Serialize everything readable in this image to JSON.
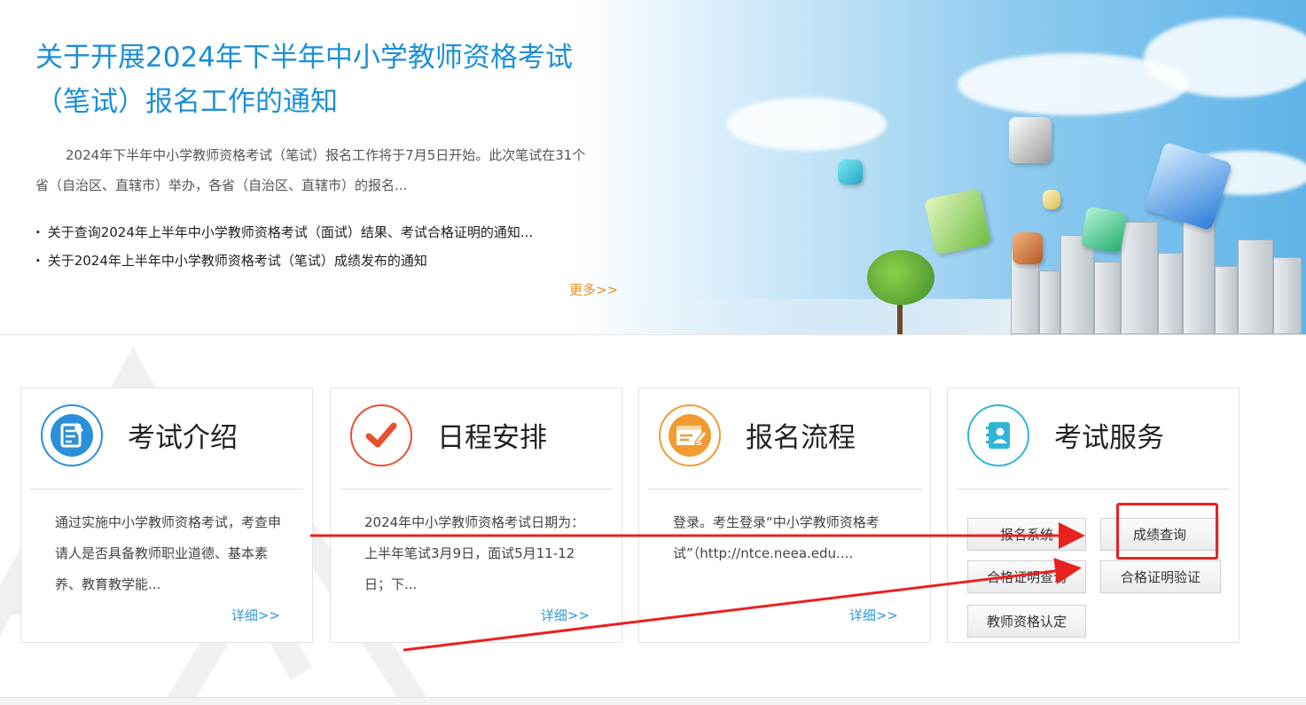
{
  "news": {
    "title": "关于开展2024年下半年中小学教师资格考试（笔试）报名工作的通知",
    "summary": "2024年下半年中小学教师资格考试（笔试）报名工作将于7月5日开始。此次笔试在31个省（自治区、直辖市）举办，各省（自治区、直辖市）的报名...",
    "items": [
      "关于查询2024年上半年中小学教师资格考试（面试）结果、考试合格证明的通知...",
      "关于2024年上半年中小学教师资格考试（笔试）成绩发布的通知"
    ],
    "more": "更多>>"
  },
  "cards": {
    "intro": {
      "title": "考试介绍",
      "icon": "document-edit-icon",
      "text": "通过实施中小学教师资格考试，考查申请人是否具备教师职业道德、基本素养、教育教学能...",
      "detail": "详细>>"
    },
    "schedule": {
      "title": "日程安排",
      "icon": "checkmark-icon",
      "text": "2024年中小学教师资格考试日期为：上半年笔试3月9日，面试5月11-12日；下...",
      "detail": "详细>>"
    },
    "registration": {
      "title": "报名流程",
      "icon": "browser-edit-icon",
      "text": "登录。考生登录“中小学教师资格考试”（http://ntce.neea.edu....",
      "detail": "详细>>"
    },
    "service": {
      "title": "考试服务",
      "icon": "contact-book-icon",
      "buttons": [
        "报名系统",
        "成绩查询",
        "合格证明查询",
        "合格证明验证",
        "教师资格认定"
      ]
    }
  },
  "colors": {
    "title_blue": "#1b8fd8",
    "more_orange": "#f08c1e",
    "annotation_red": "#e8221f",
    "intro_icon": "#2b8fd9",
    "schedule_icon": "#e8502f",
    "registration_icon": "#f29b33",
    "service_icon": "#2fb5d6"
  }
}
